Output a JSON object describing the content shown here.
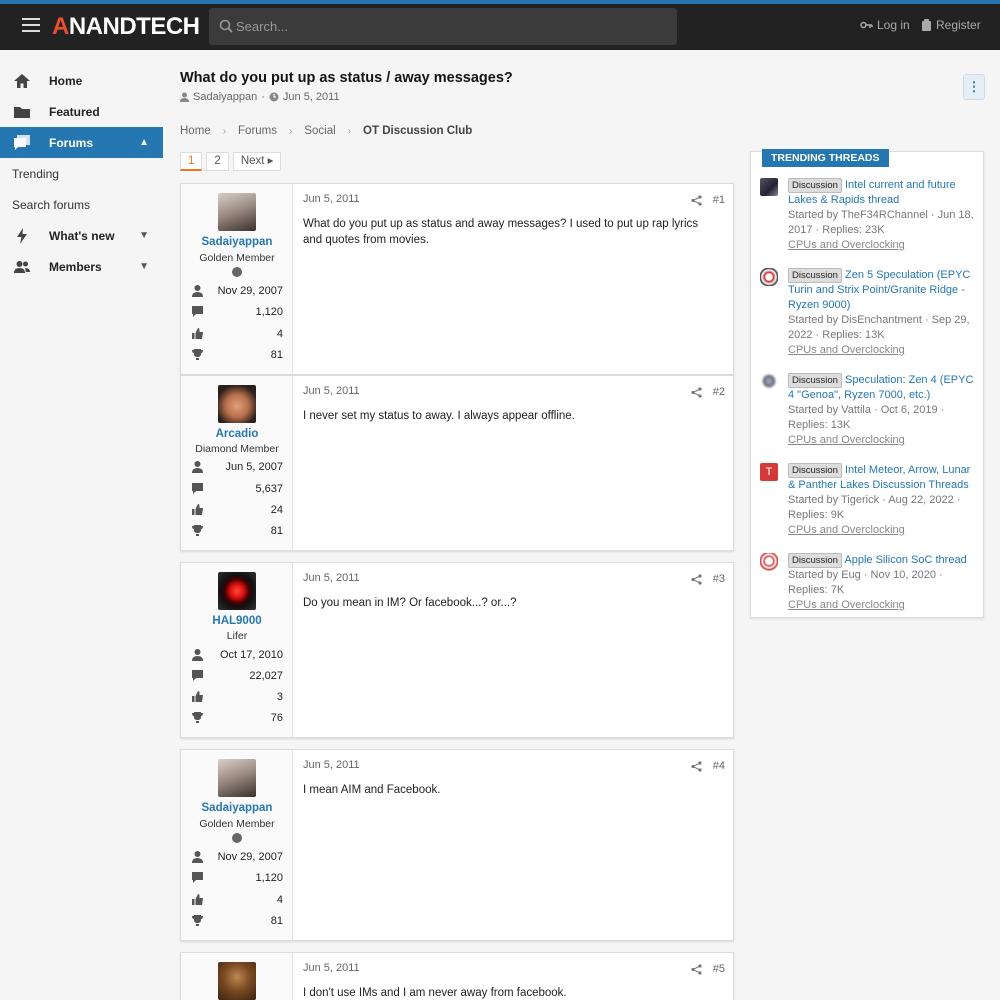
{
  "header": {
    "logo": "ANANDTECH",
    "search_placeholder": "Search...",
    "login": "Log in",
    "register": "Register"
  },
  "nav": {
    "home": "Home",
    "featured": "Featured",
    "forums": "Forums",
    "trending": "Trending",
    "search_forums": "Search forums",
    "whats_new": "What's new",
    "members": "Members"
  },
  "thread": {
    "title": "What do you put up as status / away messages?",
    "author": "Sadaiyappan",
    "date": "Jun 5, 2011",
    "breadcrumbs": [
      "Home",
      "Forums",
      "Social",
      "OT Discussion Club"
    ],
    "pages": [
      "1",
      "2"
    ],
    "next": "Next"
  },
  "posts": [
    {
      "user": "Sadaiyappan",
      "title": "Golden Member",
      "joined": "Nov 29, 2007",
      "messages": "1,120",
      "reactions": "4",
      "points": "81",
      "date": "Jun 5, 2011",
      "num": "#1",
      "body": "What do you put up as status and away messages? I used to put up rap lyrics and quotes from movies."
    },
    {
      "user": "Arcadio",
      "title": "Diamond Member",
      "joined": "Jun 5, 2007",
      "messages": "5,637",
      "reactions": "24",
      "points": "81",
      "date": "Jun 5, 2011",
      "num": "#2",
      "body": "I never set my status to away. I always appear offline."
    },
    {
      "user": "HAL9000",
      "title": "Lifer",
      "joined": "Oct 17, 2010",
      "messages": "22,027",
      "reactions": "3",
      "points": "76",
      "date": "Jun 5, 2011",
      "num": "#3",
      "body": "Do you mean in IM? Or facebook...? or...?"
    },
    {
      "user": "Sadaiyappan",
      "title": "Golden Member",
      "joined": "Nov 29, 2007",
      "messages": "1,120",
      "reactions": "4",
      "points": "81",
      "date": "Jun 5, 2011",
      "num": "#4",
      "body": "I mean AIM and Facebook."
    },
    {
      "date": "Jun 5, 2011",
      "num": "#5",
      "body": "I don't use IMs and I am never away from facebook."
    }
  ],
  "trending": {
    "header": "Trending Threads",
    "tag": "Discussion",
    "items": [
      {
        "title": "Intel current and future Lakes & Rapids thread",
        "meta": "Started by TheF34RChannel · Jun 18, 2017 · Replies: 23K",
        "forum": "CPUs and Overclocking"
      },
      {
        "title": "Zen 5 Speculation (EPYC Turin and Strix Point/Granite Ridge - Ryzen 9000)",
        "meta": "Started by DisEnchantment · Sep 29, 2022 · Replies: 13K",
        "forum": "CPUs and Overclocking"
      },
      {
        "title": "Speculation: Zen 4 (EPYC 4 \"Genoa\", Ryzen 7000, etc.)",
        "meta": "Started by Vattila · Oct 6, 2019 · Replies: 13K",
        "forum": "CPUs and Overclocking"
      },
      {
        "title": "Intel Meteor, Arrow, Lunar & Panther Lakes Discussion Threads",
        "meta": "Started by Tigerick · Aug 22, 2022 · Replies: 9K",
        "forum": "CPUs and Overclocking"
      },
      {
        "title": "Apple Silicon SoC thread",
        "meta": "Started by Eug · Nov 10, 2020 · Replies: 7K",
        "forum": "CPUs and Overclocking"
      }
    ]
  },
  "colors": {
    "accent": "#2577b1",
    "header_bg": "#222222",
    "page_bg": "#f5f5f5",
    "pager_current": "#e87722"
  }
}
